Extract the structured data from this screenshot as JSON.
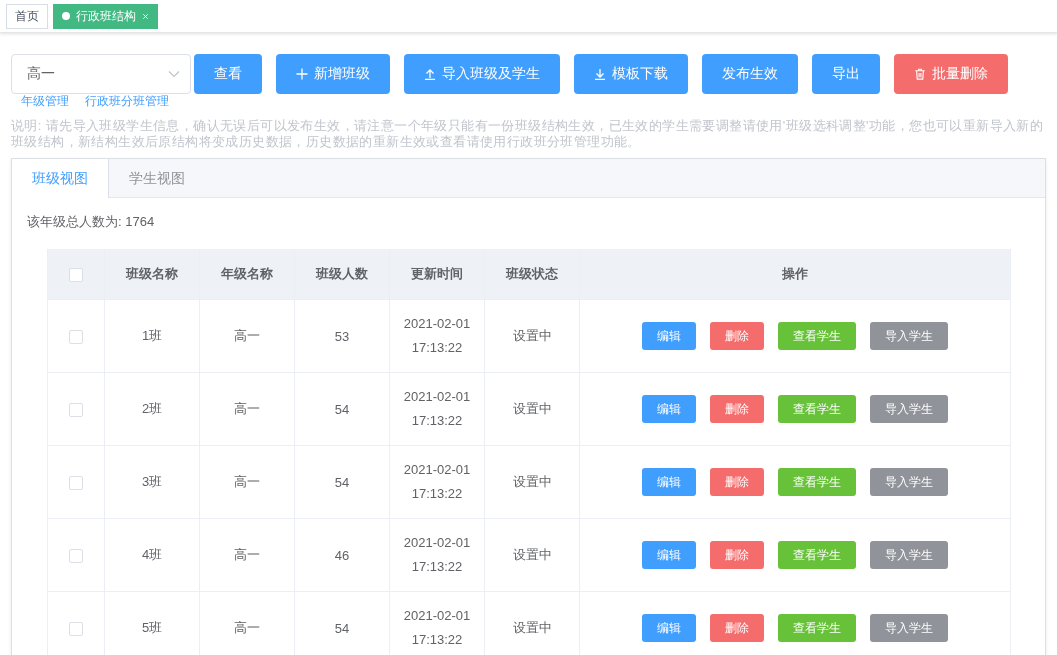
{
  "tags": [
    {
      "label": "首页",
      "selected": false
    },
    {
      "label": "行政班结构",
      "selected": true
    }
  ],
  "grade_select": {
    "value": "高一"
  },
  "toolbar": [
    {
      "label": "查看",
      "kind": "primary"
    },
    {
      "label": "新增班级",
      "kind": "primary"
    },
    {
      "label": "导入班级及学生",
      "kind": "primary"
    },
    {
      "label": "模板下载",
      "kind": "primary"
    },
    {
      "label": "发布生效",
      "kind": "primary"
    },
    {
      "label": "导出",
      "kind": "primary"
    },
    {
      "label": "批量删除",
      "kind": "danger"
    }
  ],
  "links": [
    "年级管理",
    "行政班分班管理"
  ],
  "note": "说明: 请先导入班级学生信息，确认无误后可以发布生效，请注意一个年级只能有一份班级结构生效，已生效的学生需要调整请使用'班级选科调整'功能，您也可以重新导入新的班级结构，新结构生效后原结构将变成历史数据，历史数据的重新生效或查看请使用行政班分班管理功能。",
  "tabs": [
    {
      "label": "班级视图",
      "selected": true
    },
    {
      "label": "学生视图",
      "selected": false
    }
  ],
  "total": "该年级总人数为: 1764",
  "table": {
    "select_all": {
      "checked": false
    },
    "columns": [
      "班级名称",
      "年级名称",
      "班级人数",
      "更新时间",
      "班级状态",
      "操作"
    ],
    "rows": [
      {
        "checked": false,
        "cells": [
          "1班",
          "高一",
          "53",
          "2021-02-01 17:13:22",
          "设置中"
        ],
        "actions": [
          {
            "label": "编辑",
            "kind": "primary"
          },
          {
            "label": "删除",
            "kind": "danger"
          },
          {
            "label": "查看学生",
            "kind": "success"
          },
          {
            "label": "导入学生",
            "kind": "info"
          }
        ]
      },
      {
        "checked": false,
        "cells": [
          "2班",
          "高一",
          "54",
          "2021-02-01 17:13:22",
          "设置中"
        ],
        "actions": [
          {
            "label": "编辑",
            "kind": "primary"
          },
          {
            "label": "删除",
            "kind": "danger"
          },
          {
            "label": "查看学生",
            "kind": "success"
          },
          {
            "label": "导入学生",
            "kind": "info"
          }
        ]
      },
      {
        "checked": false,
        "cells": [
          "3班",
          "高一",
          "54",
          "2021-02-01 17:13:22",
          "设置中"
        ],
        "actions": [
          {
            "label": "编辑",
            "kind": "primary"
          },
          {
            "label": "删除",
            "kind": "danger"
          },
          {
            "label": "查看学生",
            "kind": "success"
          },
          {
            "label": "导入学生",
            "kind": "info"
          }
        ]
      },
      {
        "checked": false,
        "cells": [
          "4班",
          "高一",
          "46",
          "2021-02-01 17:13:22",
          "设置中"
        ],
        "actions": [
          {
            "label": "编辑",
            "kind": "primary"
          },
          {
            "label": "删除",
            "kind": "danger"
          },
          {
            "label": "查看学生",
            "kind": "success"
          },
          {
            "label": "导入学生",
            "kind": "info"
          }
        ]
      },
      {
        "checked": false,
        "cells": [
          "5班",
          "高一",
          "54",
          "2021-02-01 17:13:22",
          "设置中"
        ],
        "actions": [
          {
            "label": "编辑",
            "kind": "primary"
          },
          {
            "label": "删除",
            "kind": "danger"
          },
          {
            "label": "查看学生",
            "kind": "success"
          },
          {
            "label": "导入学生",
            "kind": "info"
          }
        ]
      }
    ]
  }
}
